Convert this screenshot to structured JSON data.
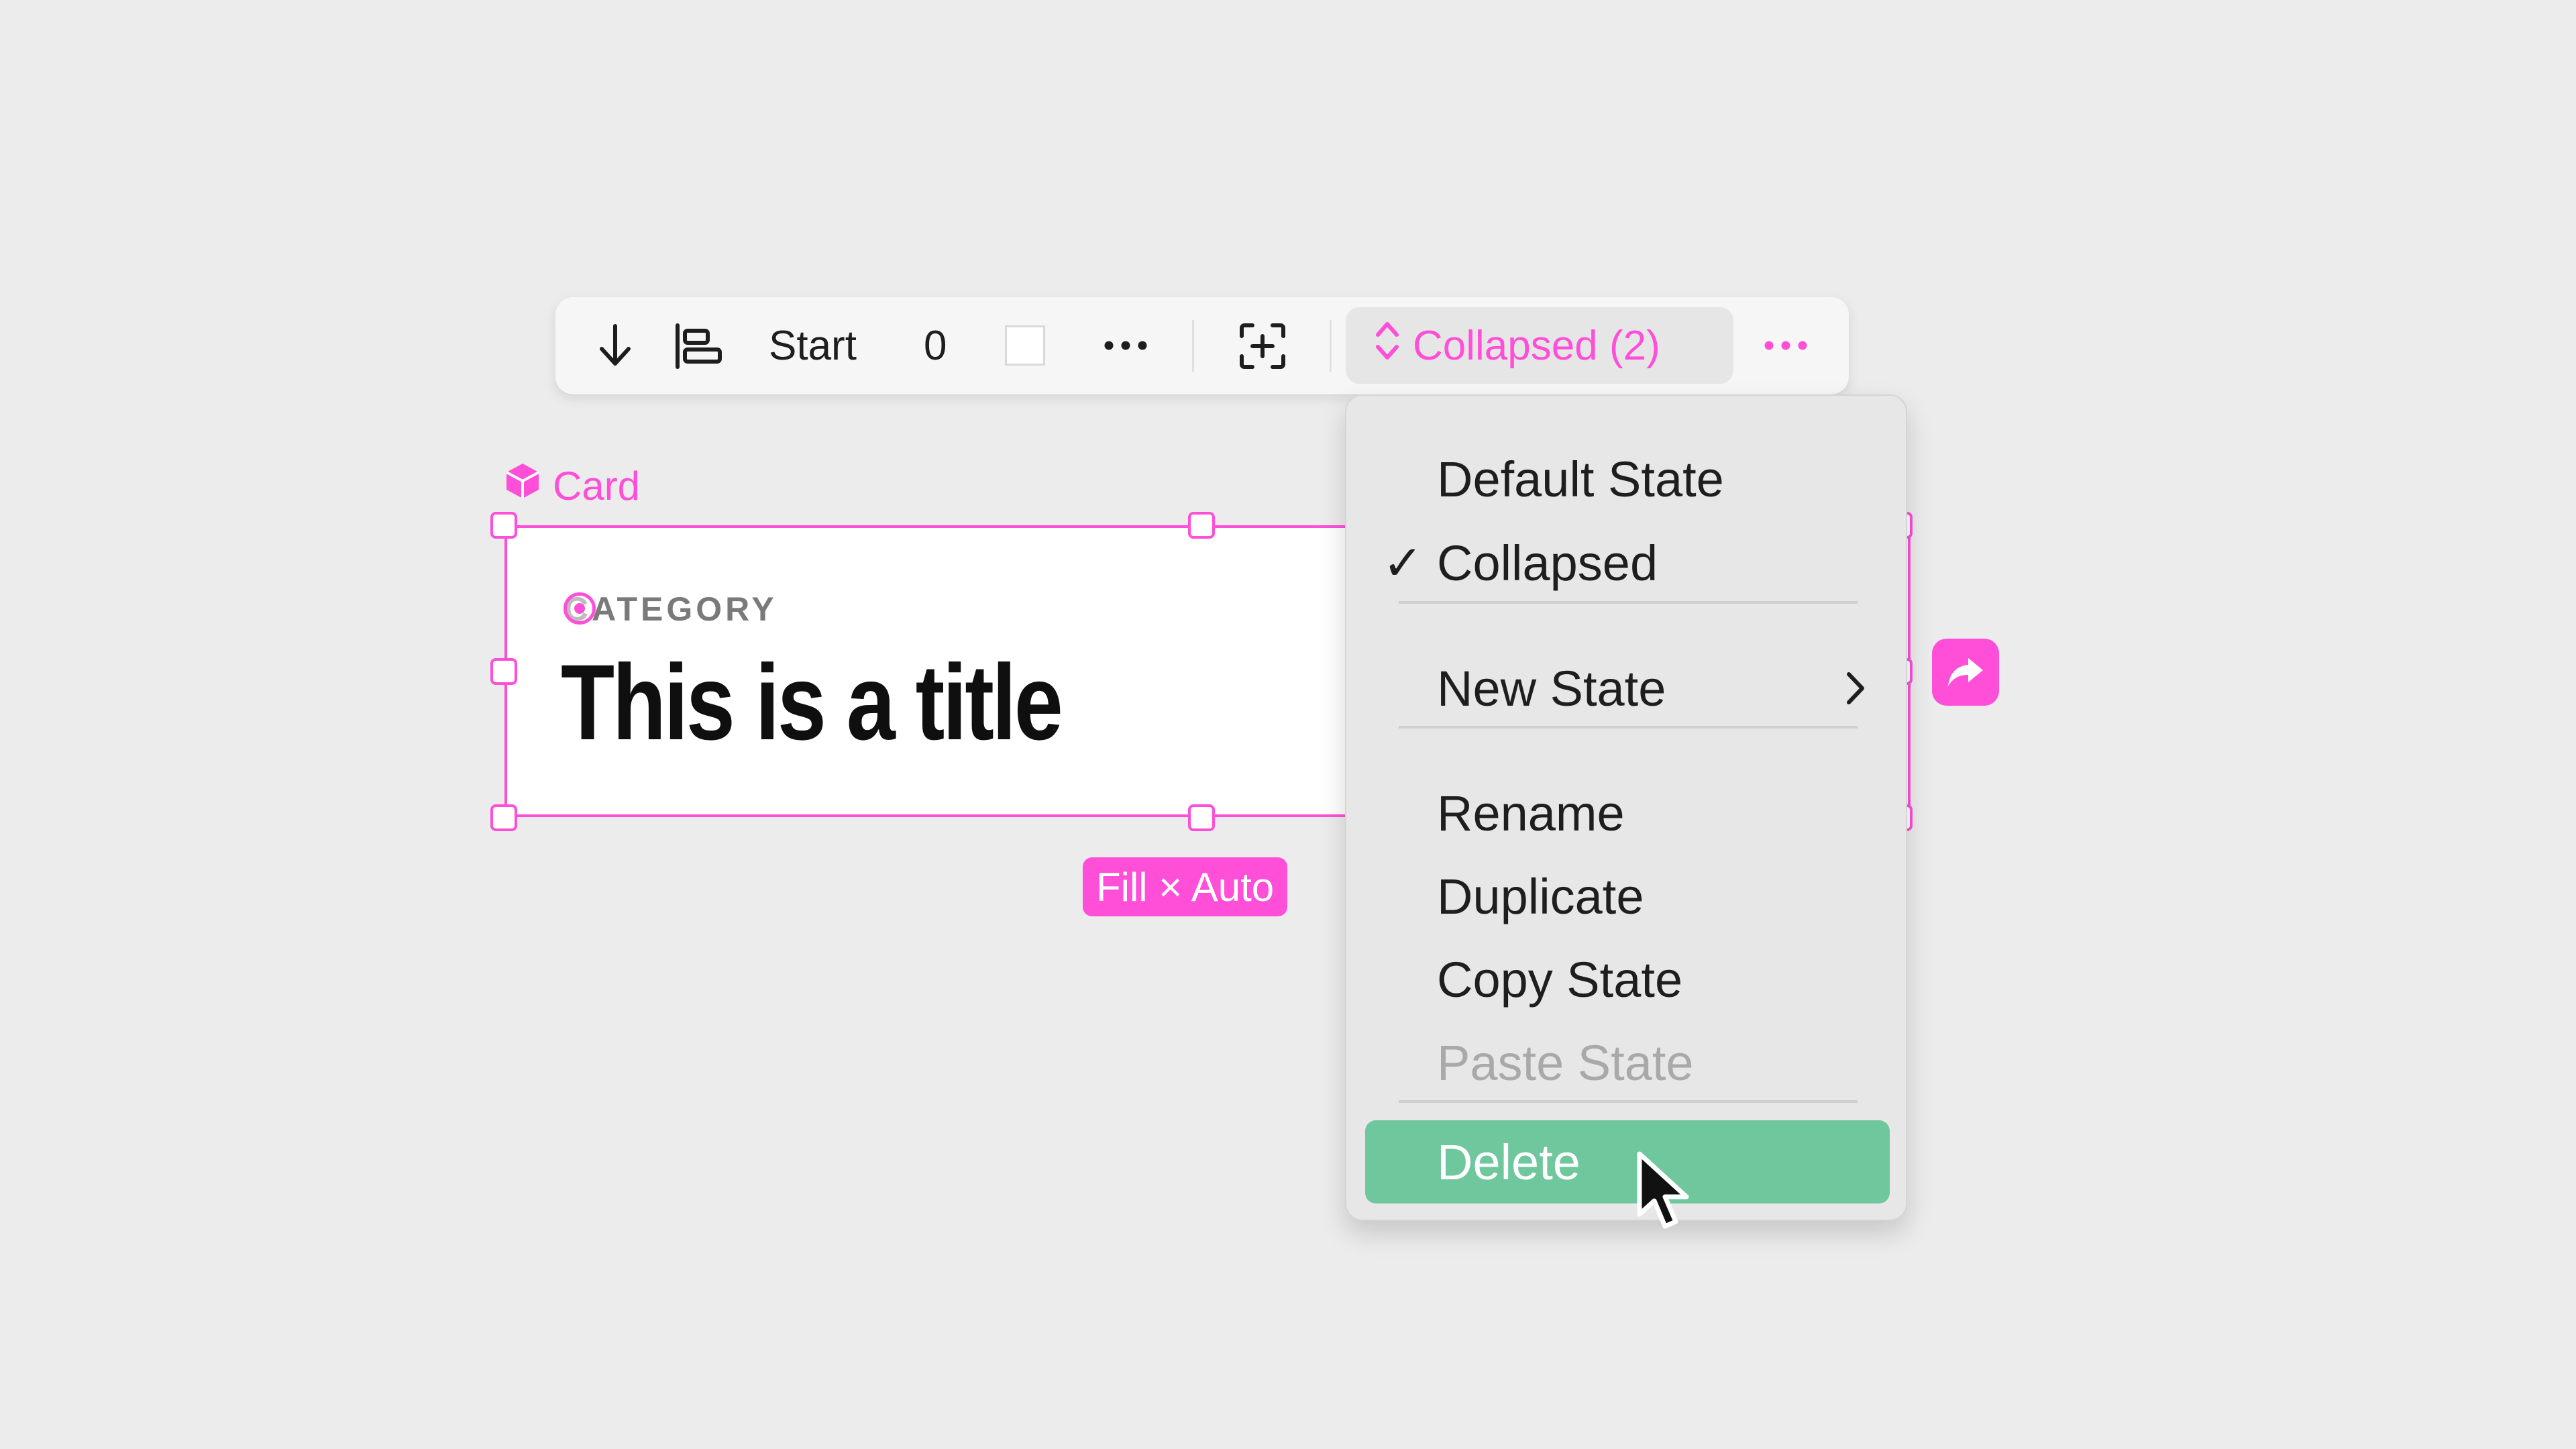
{
  "colors": {
    "accent": "#FF4FD8",
    "delete_highlight": "#6FC79D",
    "canvas": "#ECECEC"
  },
  "toolbar": {
    "direction_icon": "arrow-down-icon",
    "align_icon": "align-start-icon",
    "align_label": "Start",
    "gap_value": "0",
    "fill_swatch": "#FFFFFF",
    "more_icon": "ellipsis-icon",
    "add_frame_icon": "frame-plus-icon",
    "state_selector": {
      "icon": "up-down-chevron-icon",
      "label": "Collapsed (2)"
    },
    "overflow_icon": "ellipsis-icon"
  },
  "component": {
    "icon": "component-cube-icon",
    "name": "Card"
  },
  "card": {
    "category": "CATEGORY",
    "title": "This is a title"
  },
  "size_badge": "Fill × Auto",
  "share_icon": "share-arrow-icon",
  "menu": {
    "group1": [
      {
        "label": "Default State",
        "checked": false
      },
      {
        "label": "Collapsed",
        "checked": true,
        "check_glyph": "✓"
      }
    ],
    "new_state": {
      "label": "New State",
      "submenu_icon": "chevron-right-icon"
    },
    "group3": [
      {
        "label": "Rename",
        "enabled": true
      },
      {
        "label": "Duplicate",
        "enabled": true
      },
      {
        "label": "Copy State",
        "enabled": true
      },
      {
        "label": "Paste State",
        "enabled": false
      }
    ],
    "delete": {
      "label": "Delete",
      "highlighted": true
    }
  }
}
